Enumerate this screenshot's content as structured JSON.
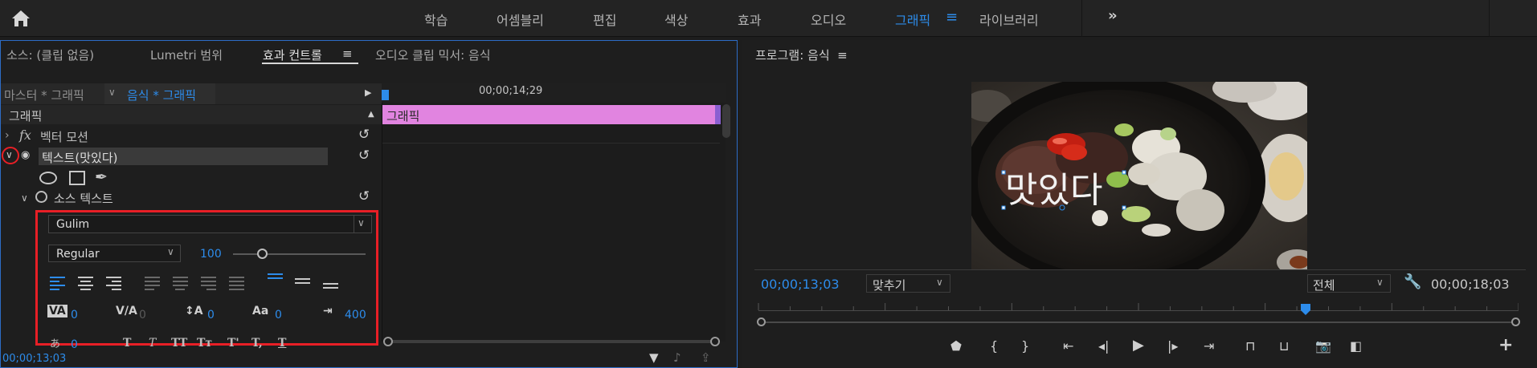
{
  "workspace": {
    "tabs": [
      "학습",
      "어셈블리",
      "편집",
      "색상",
      "효과",
      "오디오",
      "그래픽",
      "라이브러리"
    ],
    "active_tab": "그래픽",
    "menu_icon": "hamburger-icon",
    "more_icon": "double-chevron-right-icon",
    "accent_color": "#2d8ceb"
  },
  "left_panel": {
    "tabs": [
      "소스: (클립 없음)",
      "Lumetri 범위",
      "효과 컨트롤",
      "오디오 클립 믹서: 음식"
    ],
    "active_tab": "효과 컨트롤",
    "tab_menu_icon": "≡",
    "master_label": "마스터 * 그래픽",
    "clip_label": "음식 * 그래픽",
    "section_label": "그래픽",
    "vector_motion": {
      "fx": "fx",
      "label": "벡터 모션"
    },
    "text_layer": {
      "label": "텍스트(맛있다)"
    },
    "source_text": {
      "label": "소스 텍스트"
    },
    "font": "Gulim",
    "font_style": "Regular",
    "font_size": "100",
    "font_size_slider_fraction": 0.22,
    "metrics": [
      {
        "icon": "VA",
        "value": "0"
      },
      {
        "icon": "V/A",
        "value": "0",
        "dim": true
      },
      {
        "icon": "↕A",
        "value": "0"
      },
      {
        "icon": "Aa",
        "value": "0"
      },
      {
        "icon": "⇥",
        "value": "400"
      }
    ],
    "bottom_row_value": "0",
    "bottom_row_styles": [
      "T",
      "T",
      "TT",
      "Tт",
      "T'",
      "T,",
      "T"
    ],
    "timecode": "00;00;13;03",
    "highlight_color": "#e81f26"
  },
  "mini_timeline": {
    "timecode": "00;00;14;29",
    "clip_label": "그래픽",
    "clip_color": "#e184e0"
  },
  "program": {
    "title": "프로그램: 음식",
    "title_menu": "≡",
    "overlay_text": "맛있다",
    "timecode_current": "00;00;13;03",
    "fit": "맞추기",
    "resolution": "전체",
    "timecode_duration": "00;00;18;03",
    "playhead_fraction": 0.72
  }
}
